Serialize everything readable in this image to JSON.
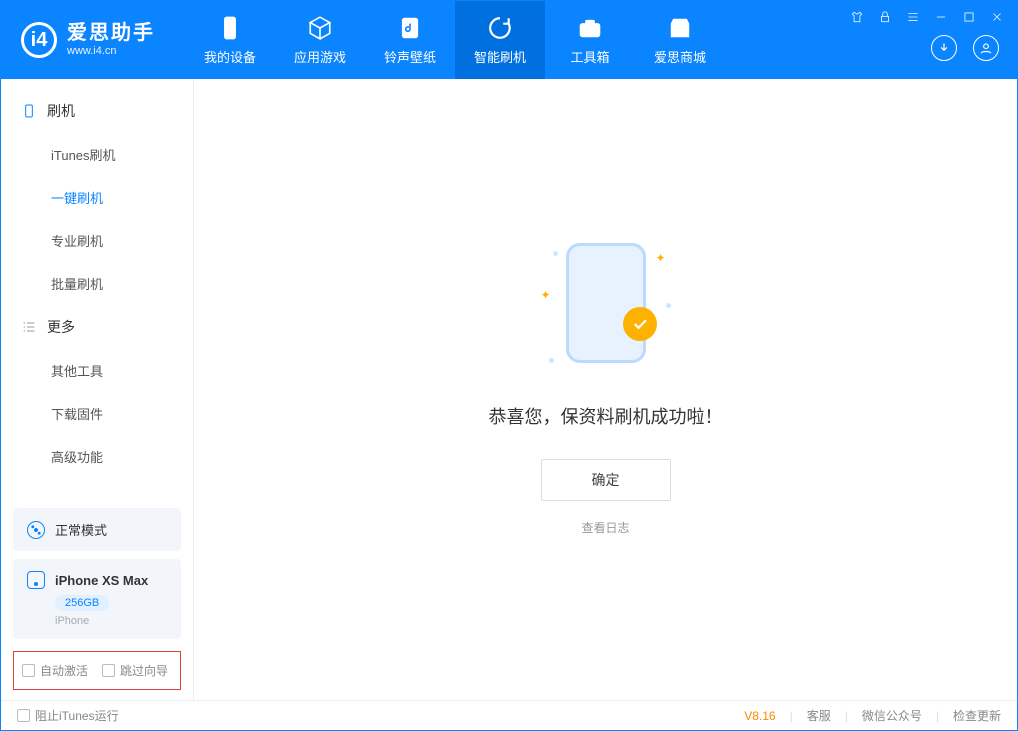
{
  "app": {
    "title": "爱思助手",
    "subtitle": "www.i4.cn"
  },
  "nav": {
    "items": [
      {
        "label": "我的设备"
      },
      {
        "label": "应用游戏"
      },
      {
        "label": "铃声壁纸"
      },
      {
        "label": "智能刷机"
      },
      {
        "label": "工具箱"
      },
      {
        "label": "爱思商城"
      }
    ]
  },
  "sidebar": {
    "group1": {
      "title": "刷机",
      "items": [
        "iTunes刷机",
        "一键刷机",
        "专业刷机",
        "批量刷机"
      ]
    },
    "group2": {
      "title": "更多",
      "items": [
        "其他工具",
        "下载固件",
        "高级功能"
      ]
    },
    "mode": {
      "label": "正常模式"
    },
    "device": {
      "name": "iPhone XS Max",
      "storage": "256GB",
      "type": "iPhone"
    },
    "checks": {
      "auto_activate": "自动激活",
      "skip_wizard": "跳过向导"
    }
  },
  "main": {
    "success_title": "恭喜您，保资料刷机成功啦！",
    "ok_button": "确定",
    "view_log": "查看日志"
  },
  "footer": {
    "block_itunes": "阻止iTunes运行",
    "version": "V8.16",
    "links": [
      "客服",
      "微信公众号",
      "检查更新"
    ]
  }
}
